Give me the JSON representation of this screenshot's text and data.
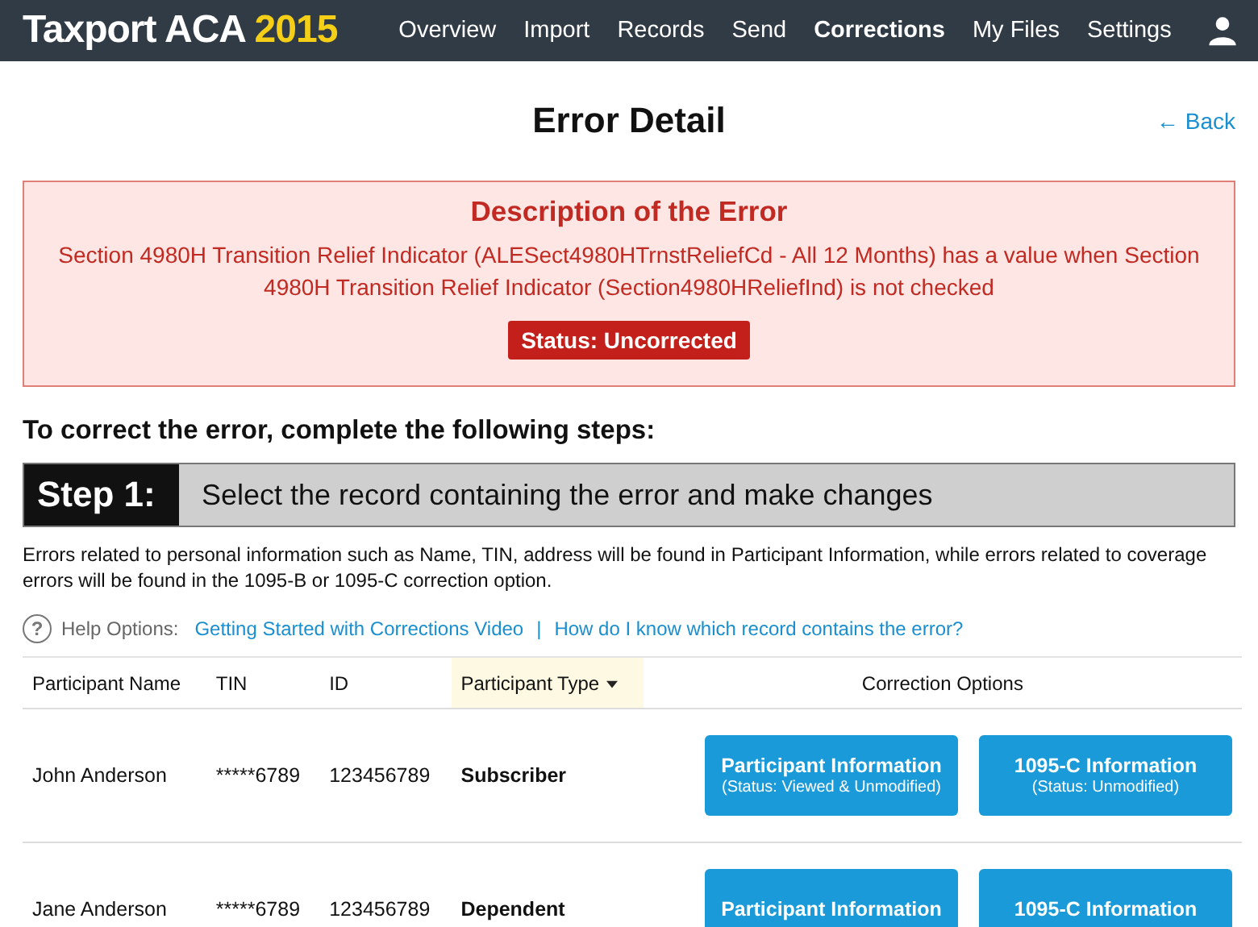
{
  "brand": {
    "name": "Taxport ACA",
    "year": "2015"
  },
  "nav": [
    {
      "label": "Overview",
      "selected": false
    },
    {
      "label": "Import",
      "selected": false
    },
    {
      "label": "Records",
      "selected": false
    },
    {
      "label": "Send",
      "selected": false
    },
    {
      "label": "Corrections",
      "selected": true
    },
    {
      "label": "My Files",
      "selected": false
    },
    {
      "label": "Settings",
      "selected": false
    }
  ],
  "page_title": "Error Detail",
  "back_link": "← Back",
  "error": {
    "heading": "Description of the Error",
    "message": "Section 4980H Transition Relief Indicator (ALESect4980HTrnstReliefCd - All 12 Months) has a value when Section 4980H Transition Relief Indicator (Section4980HReliefInd) is not checked",
    "status": "Status: Uncorrected"
  },
  "steps_heading": "To correct the error, complete the following steps:",
  "step": {
    "number": "Step 1:",
    "text": "Select the record containing the error and make changes"
  },
  "note": "Errors related to personal information such as Name, TIN, address will be found in Participant Information, while errors related to coverage errors will be found in the 1095-B or 1095-C correction option.",
  "help": {
    "icon": "?",
    "label": "Help Options:",
    "links": [
      "Getting Started with Corrections Video",
      "How do I know which record contains the error?"
    ],
    "separator": "|"
  },
  "table": {
    "columns": [
      {
        "label": "Participant Name",
        "sorted": false
      },
      {
        "label": "TIN",
        "sorted": false
      },
      {
        "label": "ID",
        "sorted": false
      },
      {
        "label": "Participant Type",
        "sorted": true
      },
      {
        "label": "Correction Options",
        "sorted": false
      }
    ],
    "rows": [
      {
        "name": "John Anderson",
        "tin": "*****6789",
        "id": "123456789",
        "type": "Subscriber",
        "buttons": [
          {
            "label": "Participant Information",
            "status": "(Status: Viewed & Unmodified)"
          },
          {
            "label": "1095-C Information",
            "status": "(Status: Unmodified)"
          }
        ]
      },
      {
        "name": "Jane Anderson",
        "tin": "*****6789",
        "id": "123456789",
        "type": "Dependent",
        "buttons": [
          {
            "label": "Participant Information"
          },
          {
            "label": "1095-C Information"
          }
        ]
      }
    ]
  }
}
